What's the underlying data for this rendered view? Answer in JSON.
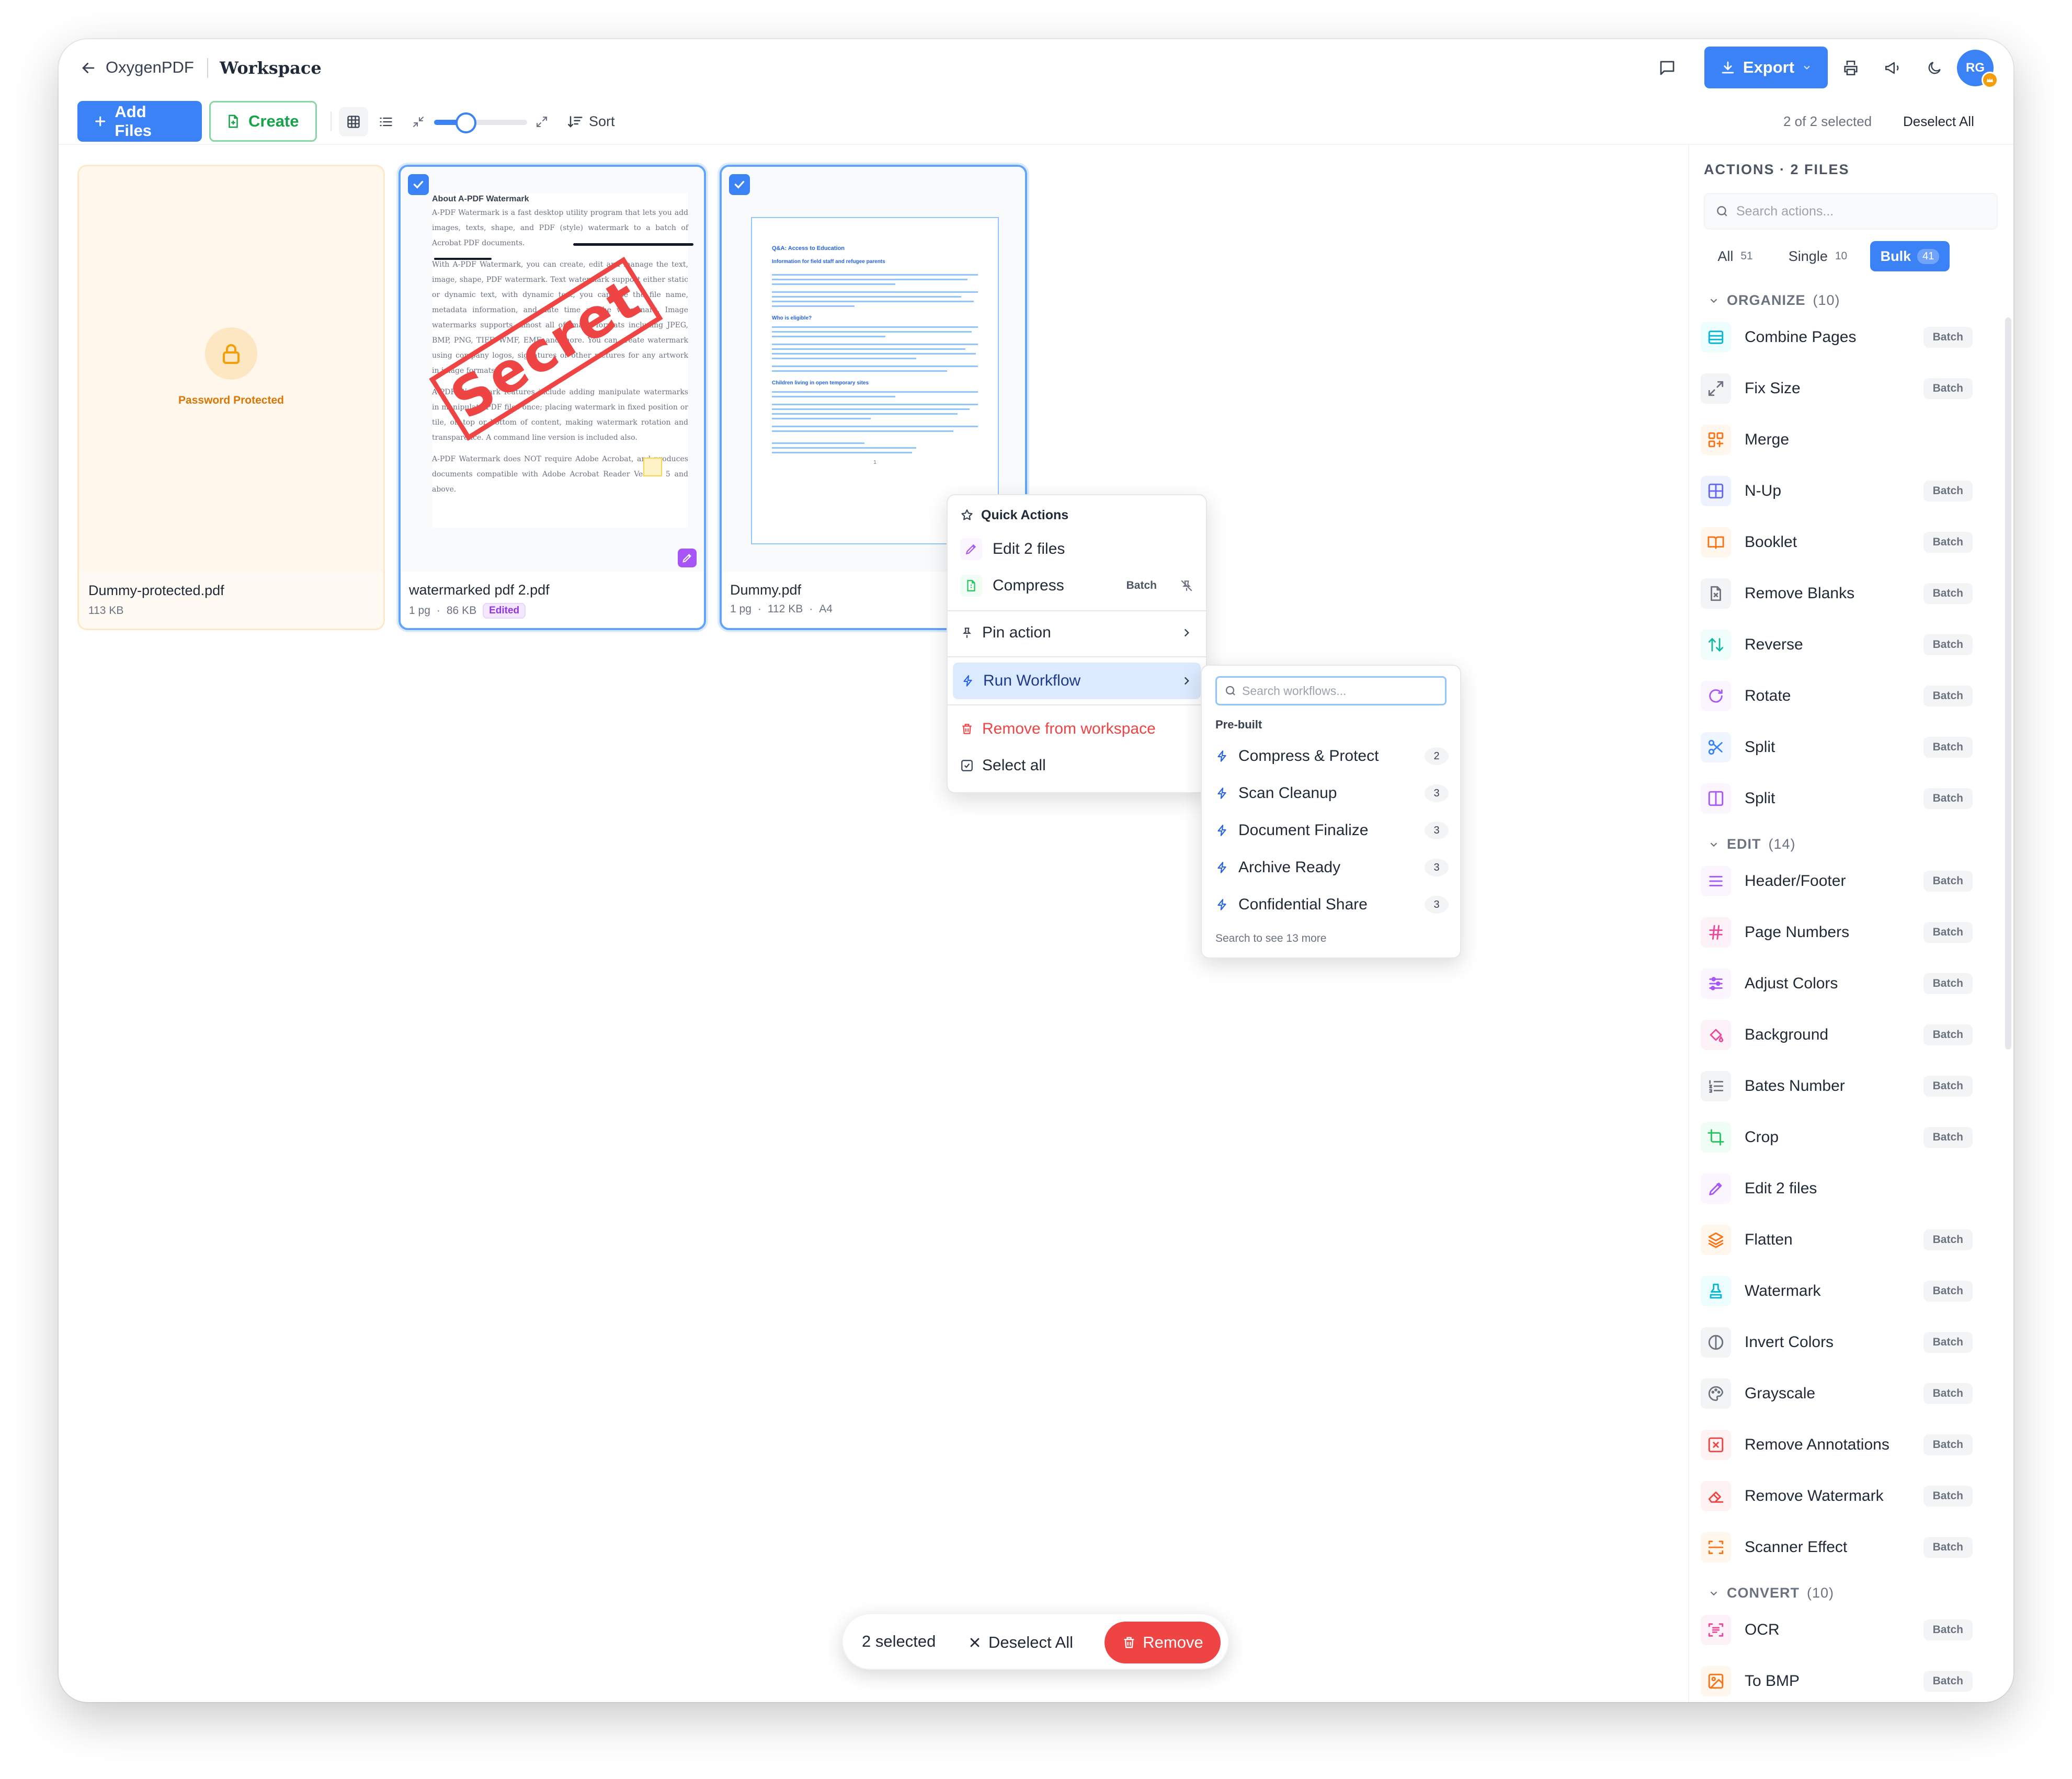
{
  "header": {
    "app_name": "OxygenPDF",
    "page_title": "Workspace",
    "export_label": "Export",
    "avatar_initials": "RG"
  },
  "toolbar": {
    "add_files": "Add Files",
    "create": "Create",
    "sort": "Sort",
    "zoom_level": 0.3,
    "selection_status": "2 of 2 selected",
    "deselect_all": "Deselect All"
  },
  "files": [
    {
      "name": "Dummy-protected.pdf",
      "meta": "113 KB",
      "locked_label": "Password Protected",
      "selected": false
    },
    {
      "name": "watermarked pdf 2.pdf",
      "pages": "1 pg",
      "size": "86 KB",
      "badge": "Edited",
      "selected": true
    },
    {
      "name": "Dummy.pdf",
      "pages": "1 pg",
      "size": "112 KB",
      "format": "A4",
      "selected": true
    }
  ],
  "doc1": {
    "heading": "About A-PDF Watermark",
    "stamp": "Secret",
    "p1": "A-PDF Watermark is a fast desktop utility program that lets you add images, texts, shape, and PDF (style) watermark to a batch of Acrobat PDF documents.",
    "p2": "With A-PDF Watermark, you can create, edit and manage the text, image, shape, PDF watermark. Text watermark support either static or dynamic text, with dynamic text, you can use the file name, metadata information, and date time as the watermark. Image watermarks supports almost all of image formats including JPEG, BMP, PNG, TIFF, WMF, EMF, and more. You can create watermark using company logos, signatures or other pictures for any artwork in image formats.",
    "p3": "A-PDF Watermark features include adding manipulate watermarks in manipulate PDF files once; placing watermark in fixed position or tile, on top or bottom of content, making watermark rotation and transparence. A command line version is included also.",
    "p4": "A-PDF Watermark does NOT require Adobe Acrobat, and produces documents compatible with Adobe Acrobat Reader Version 5 and above."
  },
  "doc2": {
    "heading": "Q&A: Access to Education",
    "subheading": "Information for field staff and refugee parents",
    "section1": "Who is eligible?",
    "section2": "Children living in open temporary sites",
    "page_number": "1"
  },
  "context_menu": {
    "title": "Quick Actions",
    "edit": "Edit 2 files",
    "compress": "Compress",
    "compress_badge": "Batch",
    "pin": "Pin action",
    "run_workflow": "Run Workflow",
    "remove": "Remove from workspace",
    "select_all": "Select all"
  },
  "workflow_menu": {
    "search_placeholder": "Search workflows...",
    "section": "Pre-built",
    "items": [
      {
        "label": "Compress & Protect",
        "count": "2"
      },
      {
        "label": "Scan Cleanup",
        "count": "3"
      },
      {
        "label": "Document Finalize",
        "count": "3"
      },
      {
        "label": "Archive Ready",
        "count": "3"
      },
      {
        "label": "Confidential Share",
        "count": "3"
      }
    ],
    "footer": "Search to see 13 more"
  },
  "sidebar": {
    "title": "ACTIONS · 2 FILES",
    "search_placeholder": "Search actions...",
    "tabs": [
      {
        "label": "All",
        "count": "51"
      },
      {
        "label": "Single",
        "count": "10"
      },
      {
        "label": "Bulk",
        "count": "41"
      }
    ],
    "sections": {
      "organize": {
        "label": "ORGANIZE",
        "count": "(10)"
      },
      "edit": {
        "label": "EDIT",
        "count": "(14)"
      },
      "convert": {
        "label": "CONVERT",
        "count": "(10)"
      }
    },
    "batch_label": "Batch",
    "actions": [
      {
        "label": "Combine Pages",
        "icon": "rows-icon",
        "color": "#06b6d4",
        "bg": "#ecfeff",
        "batch": true
      },
      {
        "label": "Fix Size",
        "icon": "expand-icon",
        "color": "#6b7280",
        "bg": "#f3f4f6",
        "batch": true
      },
      {
        "label": "Merge",
        "icon": "merge-icon",
        "color": "#f97316",
        "bg": "#fff7ed",
        "batch": false
      },
      {
        "label": "N-Up",
        "icon": "grid-icon",
        "color": "#6366f1",
        "bg": "#eef2ff",
        "batch": true
      },
      {
        "label": "Booklet",
        "icon": "book-icon",
        "color": "#f97316",
        "bg": "#fff7ed",
        "batch": true
      },
      {
        "label": "Remove Blanks",
        "icon": "file-x-icon",
        "color": "#6b7280",
        "bg": "#f3f4f6",
        "batch": true
      },
      {
        "label": "Reverse",
        "icon": "arrows-updown-icon",
        "color": "#14b8a6",
        "bg": "#f0fdfa",
        "batch": true
      },
      {
        "label": "Rotate",
        "icon": "rotate-icon",
        "color": "#a855f7",
        "bg": "#faf5ff",
        "batch": true
      },
      {
        "label": "Split",
        "icon": "scissors-icon",
        "color": "#3b82f6",
        "bg": "#eff6ff",
        "batch": true
      },
      {
        "label": "Split",
        "icon": "columns-icon",
        "color": "#a855f7",
        "bg": "#faf5ff",
        "batch": true
      },
      {
        "label": "Header/Footer",
        "icon": "menu-lines-icon",
        "color": "#a855f7",
        "bg": "#faf5ff",
        "batch": true
      },
      {
        "label": "Page Numbers",
        "icon": "hash-icon",
        "color": "#ec4899",
        "bg": "#fdf2f8",
        "batch": true
      },
      {
        "label": "Adjust Colors",
        "icon": "sliders-icon",
        "color": "#a855f7",
        "bg": "#faf5ff",
        "batch": true
      },
      {
        "label": "Background",
        "icon": "paint-bucket-icon",
        "color": "#ec4899",
        "bg": "#fdf2f8",
        "batch": true
      },
      {
        "label": "Bates Number",
        "icon": "list-numbers-icon",
        "color": "#6b7280",
        "bg": "#f3f4f6",
        "batch": true
      },
      {
        "label": "Crop",
        "icon": "crop-icon",
        "color": "#22c55e",
        "bg": "#f0fdf4",
        "batch": true
      },
      {
        "label": "Edit 2 files",
        "icon": "pencil-icon",
        "color": "#a855f7",
        "bg": "#faf5ff",
        "batch": false
      },
      {
        "label": "Flatten",
        "icon": "layers-icon",
        "color": "#f97316",
        "bg": "#fff7ed",
        "batch": true
      },
      {
        "label": "Watermark",
        "icon": "stamp-icon",
        "color": "#06b6d4",
        "bg": "#ecfeff",
        "batch": true
      },
      {
        "label": "Invert Colors",
        "icon": "contrast-icon",
        "color": "#6b7280",
        "bg": "#f3f4f6",
        "batch": true
      },
      {
        "label": "Grayscale",
        "icon": "palette-icon",
        "color": "#6b7280",
        "bg": "#f3f4f6",
        "batch": true
      },
      {
        "label": "Remove Annotations",
        "icon": "square-x-icon",
        "color": "#ef4444",
        "bg": "#fef2f2",
        "batch": true
      },
      {
        "label": "Remove Watermark",
        "icon": "eraser-icon",
        "color": "#ef4444",
        "bg": "#fef2f2",
        "batch": true
      },
      {
        "label": "Scanner Effect",
        "icon": "scan-icon",
        "color": "#f97316",
        "bg": "#fff7ed",
        "batch": true
      },
      {
        "label": "OCR",
        "icon": "scan-text-icon",
        "color": "#ec4899",
        "bg": "#fdf2f8",
        "batch": true
      },
      {
        "label": "To BMP",
        "icon": "image-icon",
        "color": "#f97316",
        "bg": "#fff7ed",
        "batch": true
      }
    ]
  },
  "bottom_bar": {
    "selected": "2 selected",
    "deselect_all": "Deselect All",
    "remove": "Remove"
  },
  "colors": {
    "accent": "#3b82f6",
    "danger": "#ef4444",
    "success": "#16a34a",
    "locked": "#f59e0b"
  }
}
